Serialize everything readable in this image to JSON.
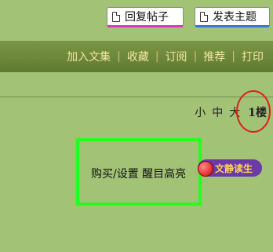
{
  "toolbar": {
    "reply_label": "回复帖子",
    "post_label": "发表主题"
  },
  "nav": {
    "items": [
      "加入文集",
      "收藏",
      "订阅",
      "推荐",
      "打印"
    ],
    "separator": "|"
  },
  "font_size": {
    "small": "小",
    "medium": "中",
    "large": "大"
  },
  "floor_label": "1楼",
  "post": {
    "buy_setting": "购买/设置 醒目高亮",
    "badge": "文静读生"
  },
  "colors": {
    "page_bg": "#a2c276",
    "nav_bg": "#6b8538",
    "nav_text": "#f3e7a1",
    "highlight_border": "#22ff22",
    "circle": "#e0201a"
  }
}
